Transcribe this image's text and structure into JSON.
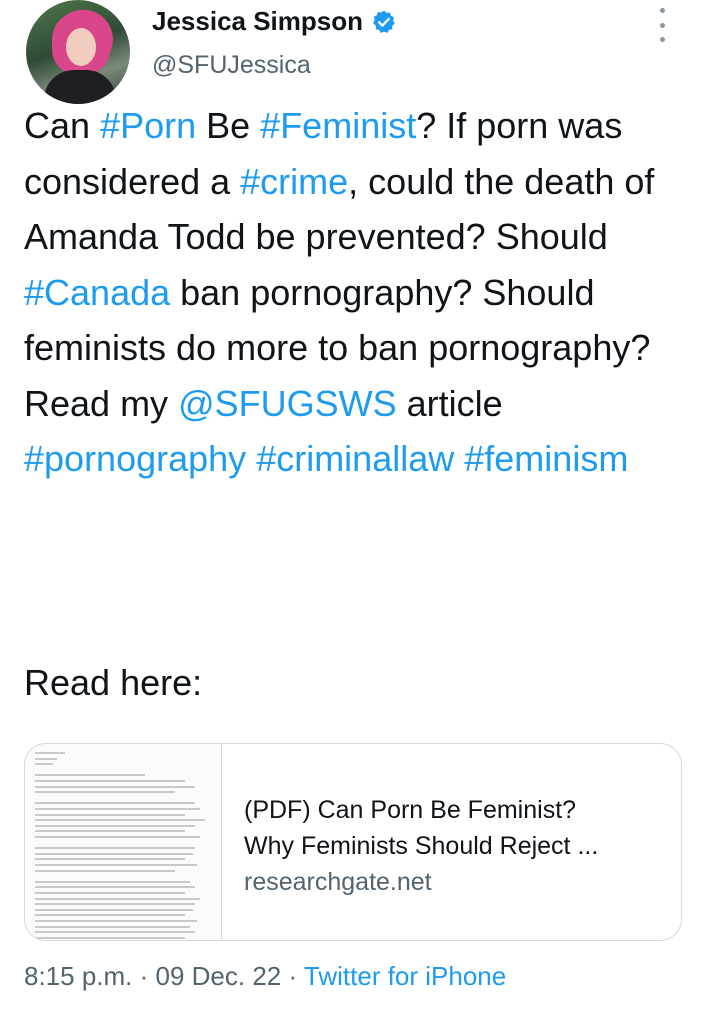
{
  "author": {
    "name": "Jessica Simpson",
    "handle": "@SFUJessica"
  },
  "tweet": {
    "segments": [
      {
        "text": "Can ",
        "tag": false
      },
      {
        "text": "#Porn",
        "tag": true
      },
      {
        "text": " Be ",
        "tag": false
      },
      {
        "text": "#Feminist",
        "tag": true
      },
      {
        "text": "? If porn was considered a ",
        "tag": false
      },
      {
        "text": "#crime",
        "tag": true
      },
      {
        "text": ", could the death of Amanda Todd be prevented? Should ",
        "tag": false
      },
      {
        "text": "#Canada",
        "tag": true
      },
      {
        "text": " ban pornography? Should feminists do more to ban pornography? Read my ",
        "tag": false
      },
      {
        "text": "@SFUGSWS",
        "tag": true
      },
      {
        "text": " article ",
        "tag": false
      },
      {
        "text": "#pornography",
        "tag": true
      },
      {
        "text": " ",
        "tag": false
      },
      {
        "text": "#criminallaw",
        "tag": true
      },
      {
        "text": " ",
        "tag": false
      },
      {
        "text": "#feminism",
        "tag": true
      }
    ],
    "read_here": "Read here:"
  },
  "link_card": {
    "title_line1": "(PDF) Can Porn Be Feminist?",
    "title_line2": "Why Feminists Should Reject ...",
    "domain": "researchgate.net"
  },
  "meta": {
    "time": "8:15 p.m.",
    "sep1": " · ",
    "date": "09 Dec. 22",
    "sep2": " · ",
    "source": "Twitter for iPhone"
  },
  "colors": {
    "accent": "#1d9bf0",
    "text": "#0f1419",
    "secondary": "#536471"
  },
  "icons": {
    "verified": "verified-badge-icon",
    "more": "more-options-icon"
  }
}
